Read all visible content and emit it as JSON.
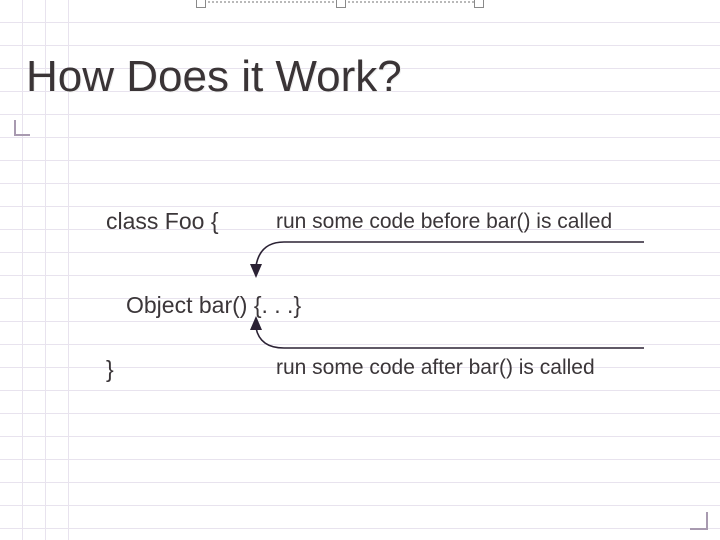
{
  "title": "How Does it Work?",
  "code": {
    "line1": "class Foo {",
    "line2": "Object bar() {. . .}",
    "line3": "}"
  },
  "annotations": {
    "before": "run some code before bar() is called",
    "after": "run some code after bar() is called"
  }
}
